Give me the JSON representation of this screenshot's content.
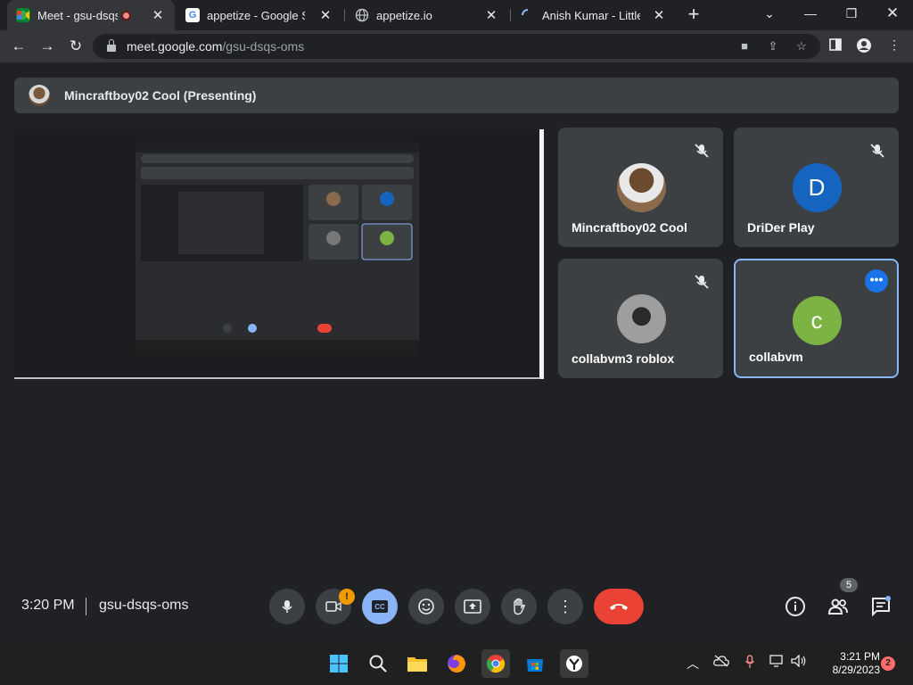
{
  "browser": {
    "tabs": [
      {
        "title": "Meet - gsu-dsqs-oms",
        "icon": "google-meet-icon",
        "recording": true
      },
      {
        "title": "appetize - Google Search",
        "icon": "google-icon"
      },
      {
        "title": "appetize.io",
        "icon": "globe-icon"
      },
      {
        "title": "Anish Kumar - Little M...",
        "icon": "loading-icon"
      }
    ],
    "url_host": "meet.google.com",
    "url_path": "/gsu-dsqs-oms"
  },
  "meet": {
    "presenter_label": "Mincraftboy02 Cool (Presenting)",
    "participants": [
      {
        "name": "Mincraftboy02 Cool",
        "initial": "",
        "avatar_type": "image",
        "muted": true
      },
      {
        "name": "DriDer Play",
        "initial": "D",
        "avatar_color": "#1565c0",
        "muted": true
      },
      {
        "name": "collabvm3 roblox",
        "initial": "",
        "avatar_type": "image",
        "muted": true
      },
      {
        "name": "collabvm",
        "initial": "c",
        "avatar_color": "#7cb342",
        "muted": false,
        "speaking": true
      }
    ],
    "time": "3:20 PM",
    "meeting_code": "gsu-dsqs-oms",
    "participant_count": "5",
    "camera_warning": "!"
  },
  "taskbar": {
    "time": "3:21 PM",
    "date": "8/29/2023",
    "notification_count": "2"
  },
  "colors": {
    "accent_blue": "#8ab4f8",
    "end_call_red": "#ea4335",
    "surface": "#3c4043",
    "background": "#202124"
  }
}
